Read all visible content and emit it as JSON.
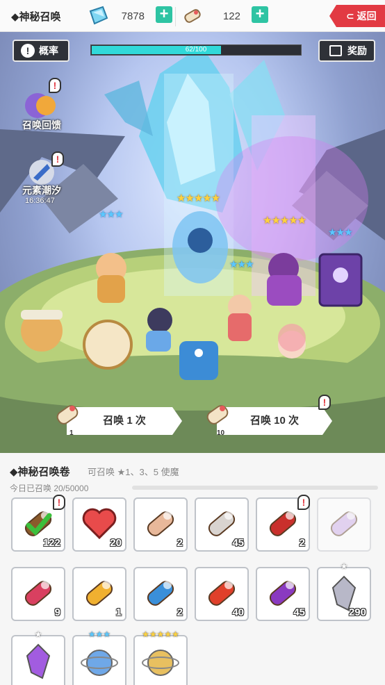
{
  "header": {
    "title": "◆神秘召唤",
    "crystal_icon": "blue-crystal-icon",
    "crystal_count": "7878",
    "scroll_icon": "summon-scroll-icon",
    "scroll_count": "122",
    "plus_label": "+",
    "return_label": "返回"
  },
  "scene": {
    "odds_label": "概率",
    "reward_label": "奖励",
    "progress": {
      "text": "62/100",
      "value": 62,
      "max": 100
    },
    "feedback_label": "召唤回馈",
    "element_tide_label": "元素潮汐",
    "element_tide_timer": "16:36:47",
    "alert_mark": "!",
    "summon_once": {
      "label": "召唤 1 次",
      "count": "1"
    },
    "summon_ten": {
      "label": "召唤 10 次",
      "count": "10"
    },
    "hero_stars": [
      {
        "stars": "★★★",
        "tier": "blue"
      },
      {
        "stars": "★★★★★",
        "tier": "gold"
      },
      {
        "stars": "★★★",
        "tier": "blue"
      },
      {
        "stars": "★★★★★",
        "tier": "gold"
      },
      {
        "stars": "★★★",
        "tier": "blue"
      }
    ]
  },
  "panel": {
    "title": "◆神秘召唤卷",
    "note": "可召唤 ★1、3、5 使魔",
    "today": "今日已召唤 20/50000",
    "items": [
      {
        "name": "mystic-scroll-selected-icon",
        "count": "122",
        "color": "#8a5a2b",
        "alert": true
      },
      {
        "name": "heart-icon",
        "count": "20",
        "color": "#e84b4b"
      },
      {
        "name": "pink-gem-scroll-icon",
        "count": "2",
        "color": "#e8b89a"
      },
      {
        "name": "white-scroll-icon",
        "count": "45",
        "color": "#d9d4d0"
      },
      {
        "name": "red-gold-scroll-icon",
        "count": "2",
        "color": "#c9302c",
        "alert": true
      },
      {
        "name": "purple-scroll-locked-icon",
        "count": "",
        "color": "#c8a6e8",
        "dim": true
      },
      {
        "name": "red-scroll-icon",
        "count": "9",
        "color": "#d94060"
      },
      {
        "name": "yellow-scroll-icon",
        "count": "1",
        "color": "#f0b030"
      },
      {
        "name": "blue-scroll-icon",
        "count": "2",
        "color": "#3a8fd9"
      },
      {
        "name": "red-orb-scroll-icon",
        "count": "40",
        "color": "#e0402a"
      },
      {
        "name": "purple-orb-scroll-icon",
        "count": "45",
        "color": "#8a3ac0"
      },
      {
        "name": "silver-crystal-icon",
        "count": "290",
        "color": "#b8b8c8",
        "stars": "★"
      },
      {
        "name": "purple-crystal-icon",
        "count": "",
        "color": "#a25ce0",
        "stars": "★"
      },
      {
        "name": "blue-orb-icon",
        "count": "",
        "color": "#6fa8e8",
        "stars": "★★★"
      },
      {
        "name": "gold-orb-icon",
        "count": "",
        "color": "#e8c060",
        "stars": "★★★★★"
      }
    ]
  }
}
